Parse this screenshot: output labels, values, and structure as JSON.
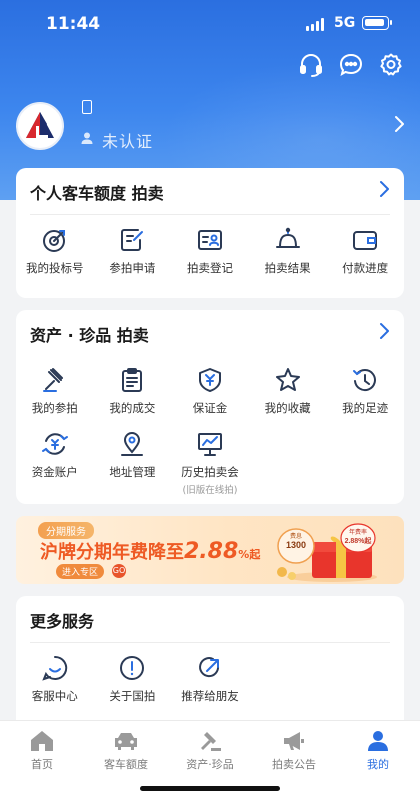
{
  "status_bar": {
    "time": "11:44",
    "network": "5G"
  },
  "header_icons": [
    "headset-icon",
    "chat-icon",
    "settings-icon"
  ],
  "profile": {
    "status": "未认证"
  },
  "personal_auction": {
    "title": "个人客车额度 拍卖",
    "items": [
      {
        "label": "我的投标号",
        "icon": "target-icon"
      },
      {
        "label": "参拍申请",
        "icon": "edit-icon"
      },
      {
        "label": "拍卖登记",
        "icon": "id-card-icon"
      },
      {
        "label": "拍卖结果",
        "icon": "bell-icon"
      },
      {
        "label": "付款进度",
        "icon": "wallet-icon"
      }
    ]
  },
  "asset_auction": {
    "title": "资产 · 珍品 拍卖",
    "items": [
      {
        "label": "我的参拍",
        "icon": "gavel-icon"
      },
      {
        "label": "我的成交",
        "icon": "clipboard-icon"
      },
      {
        "label": "保证金",
        "icon": "shield-yen-icon"
      },
      {
        "label": "我的收藏",
        "icon": "star-icon"
      },
      {
        "label": "我的足迹",
        "icon": "history-icon"
      },
      {
        "label": "资金账户",
        "icon": "yen-cycle-icon"
      },
      {
        "label": "地址管理",
        "icon": "location-icon"
      },
      {
        "label": "历史拍卖会",
        "sub": "(旧版在线拍)",
        "icon": "chart-board-icon"
      }
    ]
  },
  "banner": {
    "tag": "分期服务",
    "headline_prefix": "沪牌分期年费降至",
    "rate": "2.88",
    "unit": "%",
    "qi": "起",
    "enter": "进入专区",
    "go": "GO",
    "gift_top": "费息",
    "gift_amount": "1300",
    "gift_note": "年费率",
    "gift_rate": "2.88%起"
  },
  "more_services": {
    "title": "更多服务",
    "items": [
      {
        "label": "客服中心",
        "icon": "smile-chat-icon"
      },
      {
        "label": "关于国拍",
        "icon": "info-icon"
      },
      {
        "label": "推荐给朋友",
        "icon": "share-icon"
      }
    ]
  },
  "tabbar": {
    "tabs": [
      {
        "label": "首页",
        "icon": "home-icon",
        "active": false
      },
      {
        "label": "客车额度",
        "icon": "car-icon",
        "active": false
      },
      {
        "label": "资产·珍品",
        "icon": "gavel-icon",
        "active": false
      },
      {
        "label": "拍卖公告",
        "icon": "megaphone-icon",
        "active": false
      },
      {
        "label": "我的",
        "icon": "person-icon",
        "active": true
      }
    ]
  },
  "colors": {
    "primary": "#2a6ee0",
    "accent_orange": "#ee5a24"
  }
}
